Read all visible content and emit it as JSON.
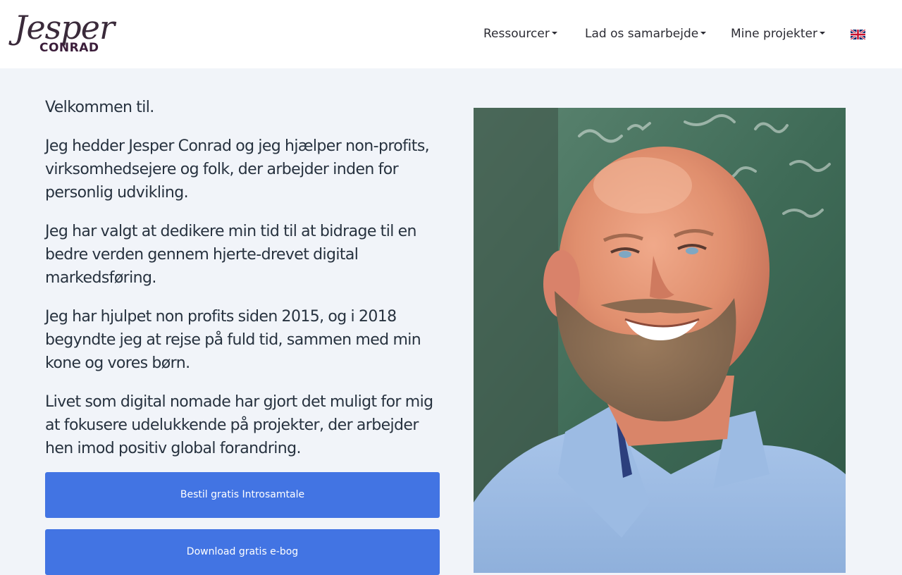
{
  "header": {
    "logo": {
      "script_text": "Jesper",
      "bold_text": "CONRAD"
    },
    "nav": [
      {
        "label": "Ressourcer",
        "has_dropdown": true
      },
      {
        "label": "Lad os samarbejde",
        "has_dropdown": true
      },
      {
        "label": "Mine projekter",
        "has_dropdown": true
      }
    ],
    "language_flag_icon": "uk-flag-icon"
  },
  "main": {
    "paragraphs": [
      "Velkommen til.",
      "Jeg hedder Jesper Conrad og jeg hjælper non-profits, virksomhedsejere og folk, der arbejder inden for personlig udvikling.",
      "Jeg har valgt at dedikere min tid til at bidrage til en bedre verden gennem hjerte-drevet digital markedsføring.",
      "Jeg har hjulpet non profits siden 2015, og i 2018 begyndte jeg at rejse på fuld tid, sammen med min kone og vores børn.",
      "Livet som digital nomade har gjort det muligt for mig at fokusere udelukkende på projekter, der arbejder hen imod positiv global forandring."
    ],
    "buttons": {
      "intro_call": "Bestil gratis Introsamtale",
      "ebook": "Download gratis e-bog"
    }
  },
  "colors": {
    "page_background": "#f1f4f9",
    "header_background": "#ffffff",
    "button_blue": "#4274e3",
    "text_dark": "#27323f"
  }
}
